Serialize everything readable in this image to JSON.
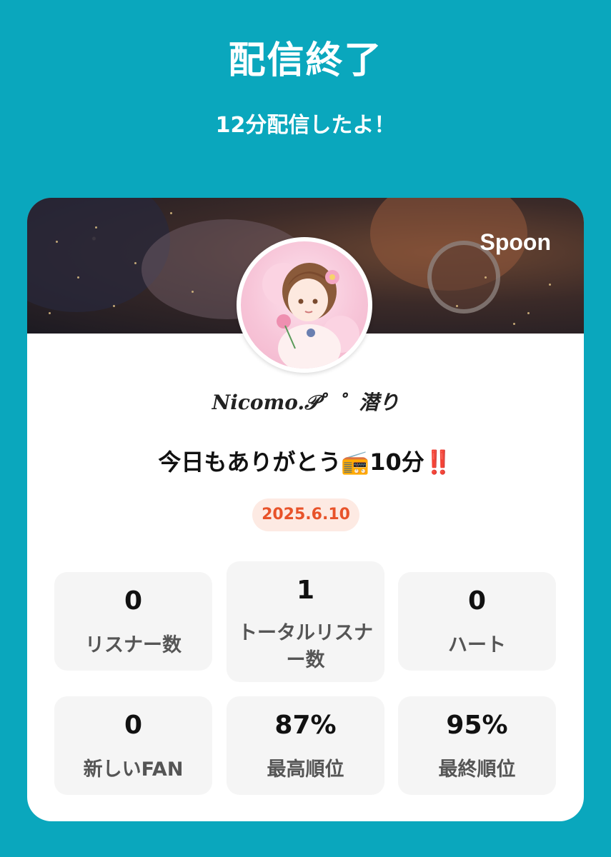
{
  "header": {
    "title": "配信終了",
    "subtitle": "12分配信したよ！"
  },
  "card": {
    "brand": "Spoon",
    "user_name": "Nicomo.𝒫゜゜潜り",
    "broadcast_title": "今日もありがとう📻10分‼️",
    "date": "2025.6.10",
    "stats": [
      {
        "value": "0",
        "label": "リスナー数"
      },
      {
        "value": "1",
        "label": "トータルリスナー数"
      },
      {
        "value": "0",
        "label": "ハート"
      },
      {
        "value": "0",
        "label": "新しいFAN"
      },
      {
        "value": "87%",
        "label": "最高順位"
      },
      {
        "value": "95%",
        "label": "最終順位"
      }
    ]
  },
  "colors": {
    "background": "#0aa7bd",
    "date_badge_text": "#e8532a",
    "date_badge_bg": "#fdeae3"
  }
}
